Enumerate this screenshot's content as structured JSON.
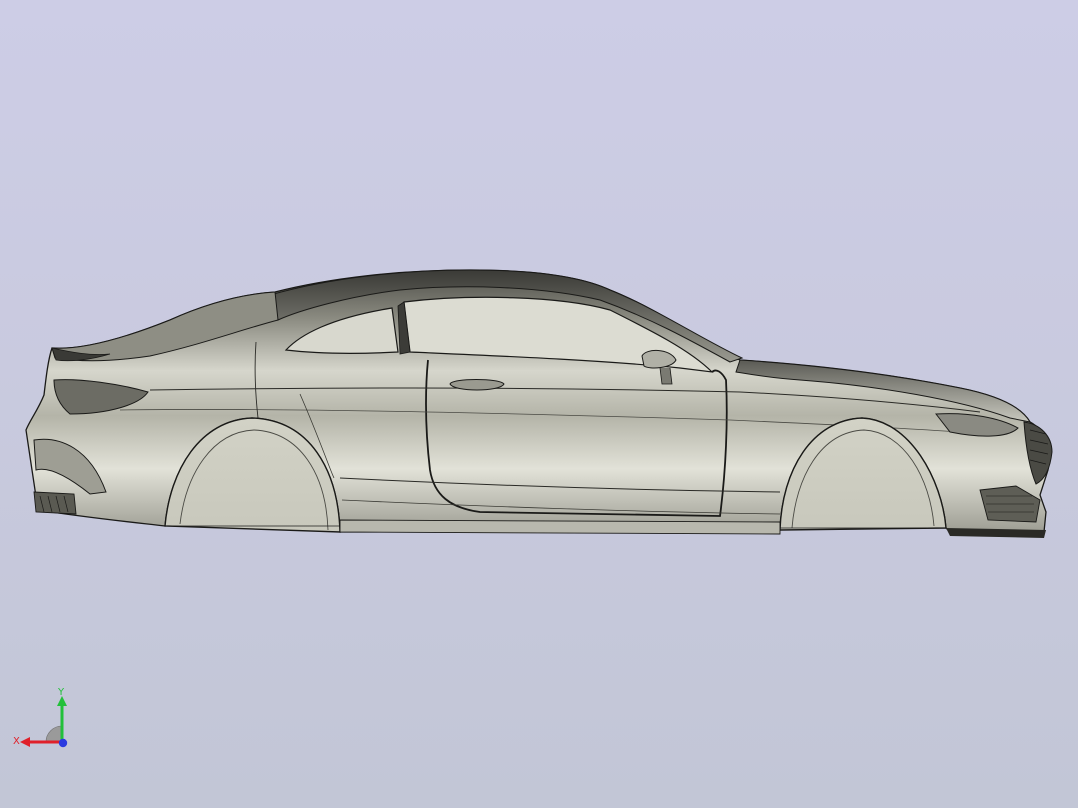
{
  "viewport": {
    "background_top": "#cdcde6",
    "background_bottom": "#c2c6d6",
    "model_name": "car-body"
  },
  "triad": {
    "x_label": "X",
    "y_label": "Y",
    "x_color": "#e0202a",
    "y_color": "#22c03a",
    "z_color": "#2a3ae0"
  }
}
